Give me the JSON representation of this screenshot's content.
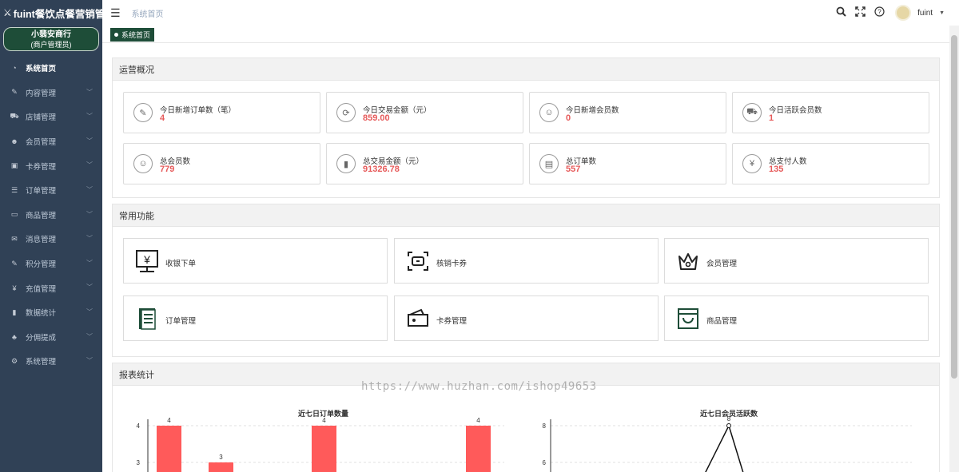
{
  "app": {
    "logo_mark": "⚔",
    "title": "fuint餐饮点餐营销管理..."
  },
  "merchant": {
    "name": "小翡安商行",
    "role": "(商户管理员)"
  },
  "sidebar": {
    "items": [
      {
        "label": "系统首页",
        "icon": "dashboard-icon",
        "glyph": "◔",
        "active": true
      },
      {
        "label": "内容管理",
        "icon": "edit-icon",
        "glyph": "✎"
      },
      {
        "label": "店铺管理",
        "icon": "cart-icon",
        "glyph": "⛟"
      },
      {
        "label": "会员管理",
        "icon": "users-icon",
        "glyph": "☻"
      },
      {
        "label": "卡券管理",
        "icon": "card-icon",
        "glyph": "▣"
      },
      {
        "label": "订单管理",
        "icon": "list-icon",
        "glyph": "☰"
      },
      {
        "label": "商品管理",
        "icon": "monitor-icon",
        "glyph": "▭"
      },
      {
        "label": "消息管理",
        "icon": "message-icon",
        "glyph": "✉"
      },
      {
        "label": "积分管理",
        "icon": "points-icon",
        "glyph": "✎"
      },
      {
        "label": "充值管理",
        "icon": "yen-icon",
        "glyph": "¥"
      },
      {
        "label": "数据统计",
        "icon": "bar-chart-icon",
        "glyph": "▮"
      },
      {
        "label": "分佣提成",
        "icon": "tree-icon",
        "glyph": "♣"
      },
      {
        "label": "系统管理",
        "icon": "gear-icon",
        "glyph": "⚙"
      }
    ]
  },
  "header": {
    "breadcrumb": "系统首页",
    "username": "fuint"
  },
  "tags": {
    "active": "系统首页"
  },
  "overview": {
    "title": "运营概况",
    "stats": [
      {
        "label": "今日新增订单数（笔）",
        "value": "4",
        "glyph": "✎"
      },
      {
        "label": "今日交易金额（元）",
        "value": "859.00",
        "glyph": "⟳"
      },
      {
        "label": "今日新增会员数",
        "value": "0",
        "glyph": "☺"
      },
      {
        "label": "今日活跃会员数",
        "value": "1",
        "glyph": "⛟"
      },
      {
        "label": "总会员数",
        "value": "779",
        "glyph": "☺"
      },
      {
        "label": "总交易金额（元）",
        "value": "91326.78",
        "glyph": "▮"
      },
      {
        "label": "总订单数",
        "value": "557",
        "glyph": "▤"
      },
      {
        "label": "总支付人数",
        "value": "135",
        "glyph": "¥"
      }
    ]
  },
  "functions": {
    "title": "常用功能",
    "items": [
      {
        "label": "收银下单",
        "icon": "cashier-icon"
      },
      {
        "label": "核销卡券",
        "icon": "scan-ticket-icon"
      },
      {
        "label": "会员管理",
        "icon": "crown-icon"
      },
      {
        "label": "订单管理",
        "icon": "order-book-icon"
      },
      {
        "label": "卡券管理",
        "icon": "wallet-icon"
      },
      {
        "label": "商品管理",
        "icon": "shopping-bag-icon"
      }
    ]
  },
  "reports": {
    "title": "报表统计"
  },
  "chart_data": [
    {
      "type": "bar",
      "title": "近七日订单数量",
      "categories": [
        "",
        "",
        "",
        "",
        "",
        "",
        ""
      ],
      "values": [
        4,
        3,
        null,
        4,
        null,
        null,
        4
      ],
      "yticks": [
        4,
        3
      ],
      "color": "#ff5a5a"
    },
    {
      "type": "line",
      "title": "近七日会员活跃数",
      "yticks": [
        8,
        6
      ],
      "values": [
        null,
        null,
        null,
        null,
        8,
        null,
        null
      ],
      "peak_label": "8",
      "color": "#111111"
    }
  ],
  "watermark": "https://www.huzhan.com/ishop49653",
  "colors": {
    "sidebar": "#304156",
    "brand_green": "#1e4d38",
    "value_red": "#e65a5a",
    "bar_red": "#ff5a5a"
  }
}
